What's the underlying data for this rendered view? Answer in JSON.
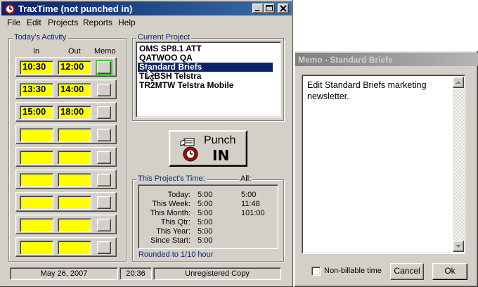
{
  "main_window": {
    "title": "TraxTime (not punched in)",
    "menu": [
      "File",
      "Edit",
      "Projects",
      "Reports",
      "Help"
    ],
    "todays_activity": {
      "label": "Today's Activity",
      "headers": {
        "in": "In",
        "out": "Out",
        "memo": "Memo"
      },
      "rows": [
        {
          "in": "10:30",
          "out": "12:00"
        },
        {
          "in": "13:30",
          "out": "14:00"
        },
        {
          "in": "15:00",
          "out": "18:00"
        },
        {
          "in": "",
          "out": ""
        },
        {
          "in": "",
          "out": ""
        },
        {
          "in": "",
          "out": ""
        },
        {
          "in": "",
          "out": ""
        },
        {
          "in": "",
          "out": ""
        },
        {
          "in": "",
          "out": ""
        }
      ]
    },
    "current_project": {
      "label": "Current Project",
      "items": [
        "OMS SP8.1 ATT",
        "QATWOO QA",
        "Standard Briefs",
        "TL2BSH Telstra",
        "TR2MTW Telstra Mobile"
      ],
      "selected": "Standard Briefs"
    },
    "punch_button": {
      "line1": "Punch",
      "line2": "IN"
    },
    "project_time": {
      "label": "This Project's Time:",
      "all_label": "All:",
      "rows": [
        {
          "label": "Today:",
          "value": "5:00",
          "all": "5:00"
        },
        {
          "label": "This Week:",
          "value": "5:00",
          "all": "11:48"
        },
        {
          "label": "This Month:",
          "value": "5:00",
          "all": "101:00"
        },
        {
          "label": "This Qtr:",
          "value": "5:00",
          "all": ""
        },
        {
          "label": "This Year:",
          "value": "5:00",
          "all": ""
        },
        {
          "label": "Since Start:",
          "value": "5:00",
          "all": ""
        }
      ],
      "rounding_note": "Rounded to 1/10 hour"
    },
    "status_bar": {
      "date": "May 26, 2007",
      "time": "20:36",
      "license": "Unregistered Copy"
    }
  },
  "memo_window": {
    "title": "Memo - Standard Briefs",
    "text": "Edit Standard Briefs marketing newsletter.",
    "non_billable_label": "Non-billable time",
    "non_billable_checked": false,
    "cancel_label": "Cancel",
    "ok_label": "Ok"
  },
  "colors": {
    "titlebar_active": "#0a246a",
    "time_field": "#ffff00",
    "selection": "#0a246a",
    "group_label": "#0a246a",
    "memo_active_highlight": "#3cc83c"
  }
}
